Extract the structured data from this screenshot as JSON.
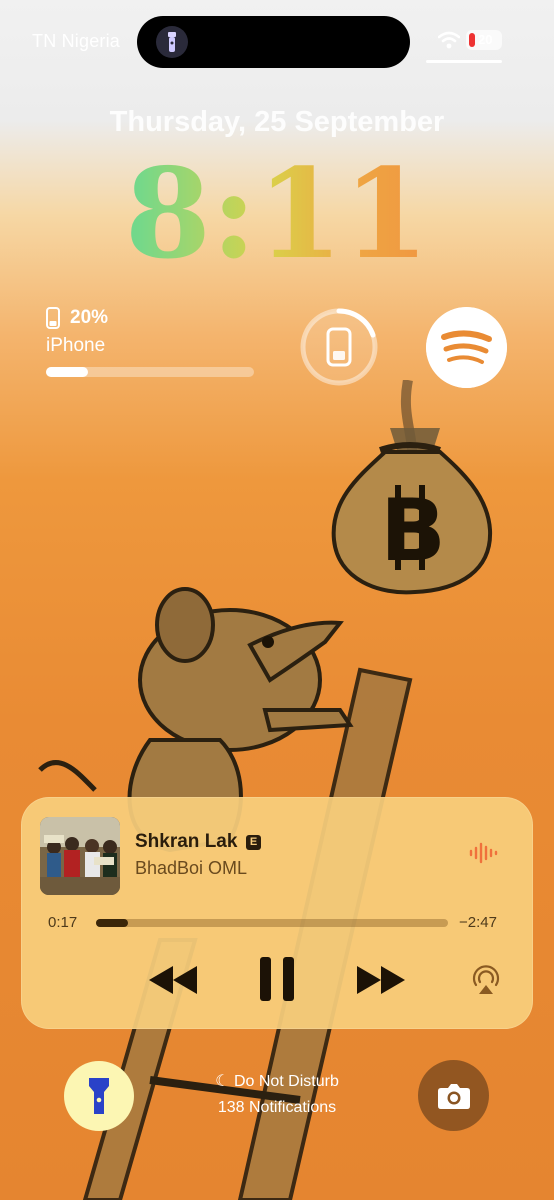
{
  "status": {
    "carrier": "TN Nigeria",
    "battery_percent": "20"
  },
  "lock": {
    "date": "Thursday, 25 September",
    "time": "8:11"
  },
  "battery_widget": {
    "percent": "20%",
    "device": "iPhone",
    "level": 0.2
  },
  "now_playing": {
    "title": "Shkran Lak",
    "explicit_badge": "E",
    "artist": "BhadBoi OML",
    "elapsed": "0:17",
    "remaining": "−2:47",
    "progress": 0.09
  },
  "bottom": {
    "dnd_label": "Do Not Disturb",
    "notifications": "138 Notifications"
  },
  "colors": {
    "accent_orange": "#e98b34",
    "player_bg": "#f8ce7c",
    "torch_bg": "#fcf6b3"
  }
}
